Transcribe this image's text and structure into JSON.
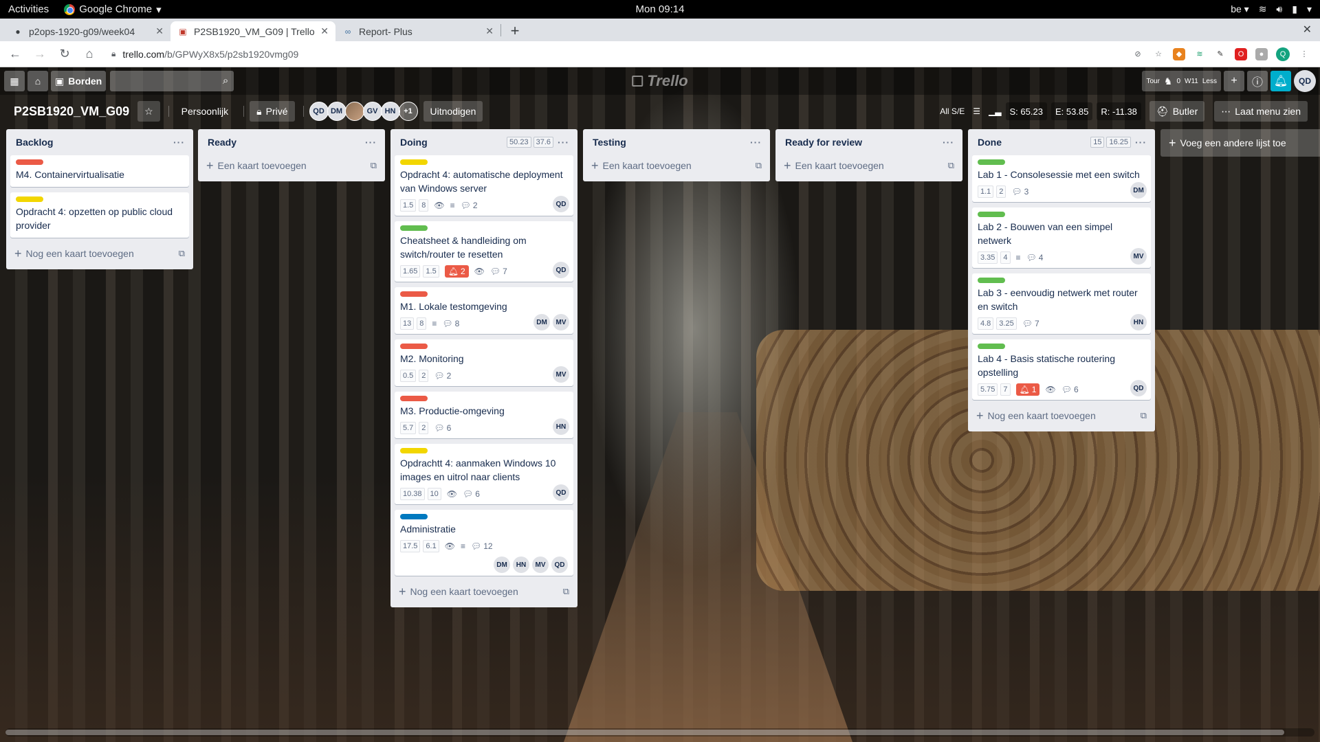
{
  "system": {
    "activities": "Activities",
    "app": "Google Chrome",
    "clock": "Mon 09:14",
    "keyboard": "be"
  },
  "browser": {
    "tabs": [
      {
        "title": "p2ops-1920-g09/week04",
        "icon": "github-icon"
      },
      {
        "title": "P2SB1920_VM_G09 | Trello",
        "icon": "trello-icon"
      },
      {
        "title": "Report- Plus",
        "icon": "report-icon"
      }
    ],
    "url_host": "trello.com",
    "url_path": "/b/GPWyX8x5/p2sb1920vmg09"
  },
  "trello": {
    "boards_label": "Borden",
    "logo": "Trello",
    "ext_badge_1": "Tour",
    "ext_badge_2": "0",
    "ext_badge_3": "W11",
    "ext_badge_4": "Less",
    "user_initials": "QD"
  },
  "board": {
    "title": "P2SB1920_VM_G09",
    "team": "Persoonlijk",
    "visibility": "Privé",
    "members": [
      "QD",
      "DM",
      "",
      "GV",
      "HN"
    ],
    "members_more": "+1",
    "invite": "Uitnodigen",
    "allse": "All S/E",
    "stat_s": "S: 65.23",
    "stat_e": "E: 53.85",
    "stat_r": "R: -11.38",
    "butler": "Butler",
    "menu": "Laat menu zien",
    "add_list": "Voeg een andere lijst toe"
  },
  "lists": [
    {
      "title": "Backlog",
      "add_label": "Nog een kaart toevoegen",
      "cards": [
        {
          "label_color": "#eb5a46",
          "title": "M4. Containervirtualisatie"
        },
        {
          "label_color": "#f2d600",
          "title": "Opdracht 4: opzetten op public cloud provider"
        }
      ]
    },
    {
      "title": "Ready",
      "add_label": "Een kaart toevoegen",
      "cards": []
    },
    {
      "title": "Doing",
      "meta": [
        "50.23",
        "37.6"
      ],
      "add_label": "Nog een kaart toevoegen",
      "cards": [
        {
          "label_color": "#f2d600",
          "title": "Opdracht 4: automatische deployment van Windows server",
          "s": "1.5",
          "e": "8",
          "comments": "2",
          "members": [
            "QD"
          ]
        },
        {
          "label_color": "#61bd4f",
          "title": "Cheatsheet & handleiding om switch/router te resetten",
          "s": "1.65",
          "e": "1.5",
          "alert": "2",
          "comments": "7",
          "members": [
            "QD"
          ]
        },
        {
          "label_color": "#eb5a46",
          "title": "M1. Lokale testomgeving",
          "s": "13",
          "e": "8",
          "comments": "8",
          "members": [
            "DM",
            "MV"
          ]
        },
        {
          "label_color": "#eb5a46",
          "title": "M2. Monitoring",
          "s": "0.5",
          "e": "2",
          "comments": "2",
          "members": [
            "MV"
          ]
        },
        {
          "label_color": "#eb5a46",
          "title": "M3. Productie-omgeving",
          "s": "5.7",
          "e": "2",
          "comments": "6",
          "members": [
            "HN"
          ]
        },
        {
          "label_color": "#f2d600",
          "title": "Opdrachtt 4: aanmaken Windows 10 images en uitrol naar clients",
          "s": "10.38",
          "e": "10",
          "comments": "6",
          "members": [
            "QD"
          ]
        },
        {
          "label_color": "#0079bf",
          "title": "Administratie",
          "s": "17.5",
          "e": "6.1",
          "comments": "12",
          "members": [
            "DM",
            "HN",
            "MV",
            "QD"
          ]
        }
      ]
    },
    {
      "title": "Testing",
      "add_label": "Een kaart toevoegen",
      "cards": []
    },
    {
      "title": "Ready for review",
      "add_label": "Een kaart toevoegen",
      "cards": []
    },
    {
      "title": "Done",
      "meta": [
        "15",
        "16.25"
      ],
      "add_label": "Nog een kaart toevoegen",
      "cards": [
        {
          "label_color": "#61bd4f",
          "title": "Lab 1 - Consolesessie met een switch",
          "s": "1.1",
          "e": "2",
          "comments": "3",
          "members": [
            "DM"
          ]
        },
        {
          "label_color": "#61bd4f",
          "title": "Lab 2 - Bouwen van een simpel netwerk",
          "s": "3.35",
          "e": "4",
          "comments": "4",
          "members": [
            "MV"
          ]
        },
        {
          "label_color": "#61bd4f",
          "title": "Lab 3 - eenvoudig netwerk met router en switch",
          "s": "4.8",
          "e": "3.25",
          "comments": "7",
          "members": [
            "HN"
          ]
        },
        {
          "label_color": "#61bd4f",
          "title": "Lab 4 - Basis statische routering opstelling",
          "s": "5.75",
          "e": "7",
          "alert": "1",
          "comments": "6",
          "members": [
            "QD"
          ]
        }
      ]
    }
  ]
}
